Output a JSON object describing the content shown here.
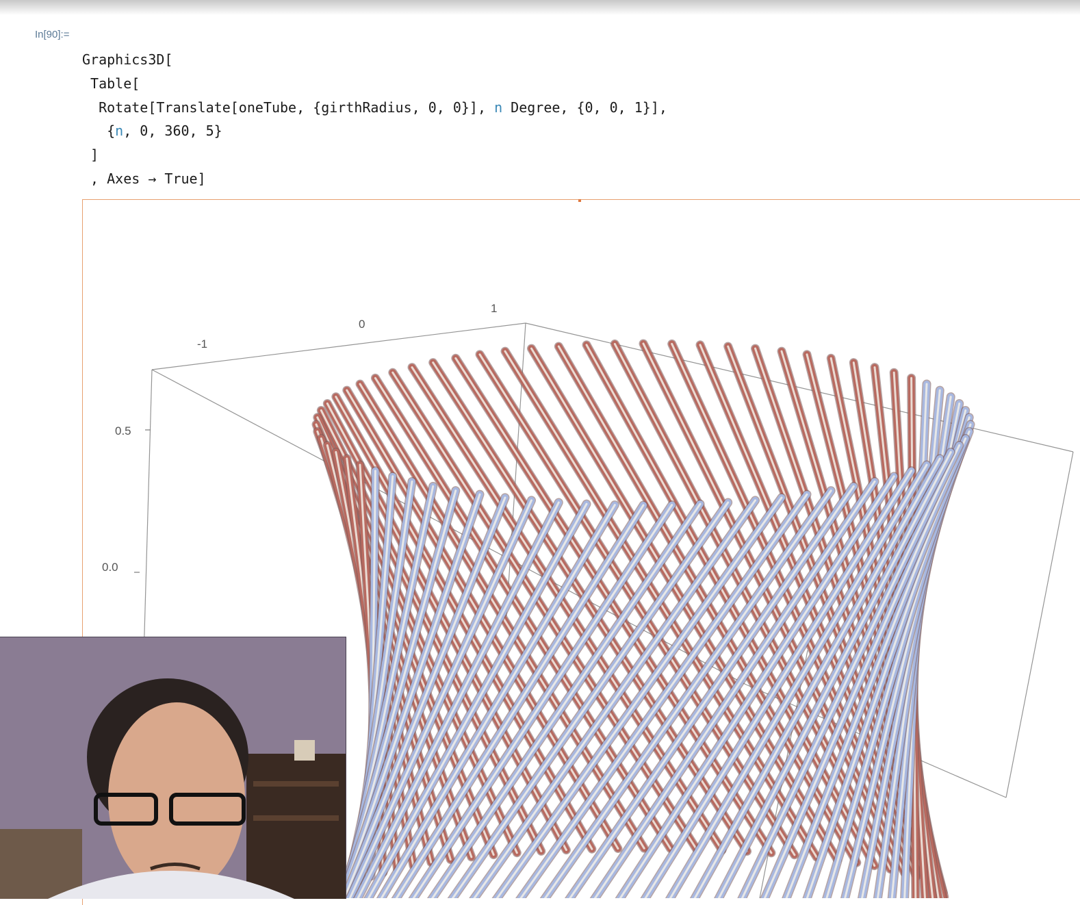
{
  "cell": {
    "input_label": "In[90]:=",
    "code_lines": [
      [
        {
          "t": "Graphics3D["
        }
      ],
      [
        {
          "t": " Table["
        }
      ],
      [
        {
          "t": "  Rotate[Translate[oneTube, {girthRadius, 0, 0}], "
        },
        {
          "t": "n",
          "var": true
        },
        {
          "t": " Degree, {0, 0, 1}],"
        }
      ],
      [
        {
          "t": "   {"
        },
        {
          "t": "n",
          "var": true
        },
        {
          "t": ", 0, 360, 5}"
        }
      ],
      [
        {
          "t": " ]"
        }
      ],
      [
        {
          "t": " , Axes → True]"
        }
      ]
    ]
  },
  "plot": {
    "x_ticks": [
      "-1",
      "0",
      "1"
    ],
    "z_ticks": [
      "0.5",
      "0.0"
    ],
    "table": {
      "variable": "n",
      "start": 0,
      "end": 360,
      "step": 5
    },
    "tube_colors": {
      "front": "#a8b8e0",
      "back": "#b86a60",
      "highlight": "#f2efe8"
    },
    "box_color": "#7a7a7a"
  },
  "webcam": {
    "description": "presenter webcam overlay",
    "wall_color": "#8a7c93",
    "shelf_color": "#3a2a22"
  }
}
